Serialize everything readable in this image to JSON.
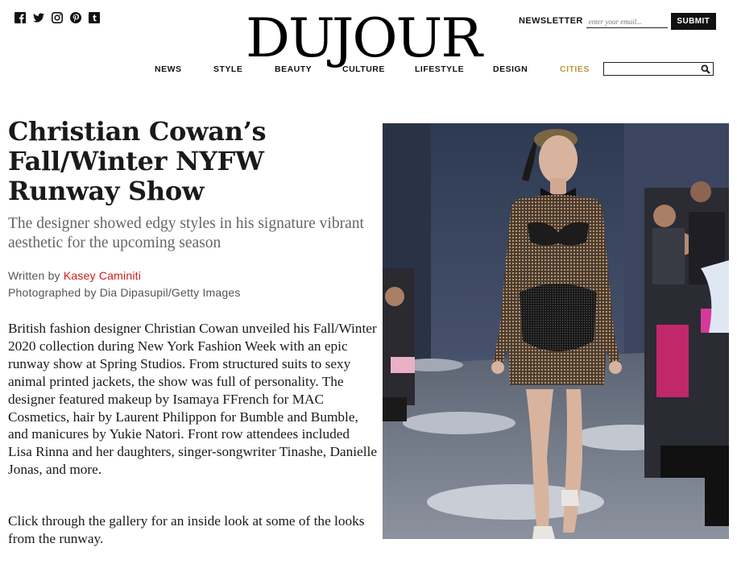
{
  "social": {
    "icons": [
      "facebook-icon",
      "twitter-icon",
      "instagram-icon",
      "pinterest-icon",
      "tumblr-icon"
    ]
  },
  "logo": {
    "text": "DUJOUR"
  },
  "newsletter": {
    "label": "NEWSLETTER",
    "placeholder": "enter your email...",
    "submit_label": "SUBMIT"
  },
  "nav": {
    "items": [
      "NEWS",
      "STYLE",
      "BEAUTY",
      "CULTURE",
      "LIFESTYLE",
      "DESIGN",
      "CITIES"
    ],
    "active_color": "#b89a3a"
  },
  "search": {
    "icon": "search-icon"
  },
  "article": {
    "headline": "Christian Cowan’s Fall/Winter NYFW Runway Show",
    "dek": "The designer showed edgy styles in his signature vibrant aesthetic for the upcoming season",
    "byline_prefix": "Written by ",
    "author": "Kasey Caminiti",
    "author_color": "#d11a1a",
    "photo_credit": "Photographed by Dia Dipasupil/Getty Images",
    "body_paragraph_1": "British fashion designer Christian Cowan unveiled his Fall/Winter 2020 collection during New York Fashion Week with an epic runway show at Spring Studios. From structured suits to sexy animal printed jackets, the show was full of personality. The designer featured makeup by Isamaya FFrench for MAC Cosmetics, hair by Laurent Philippon for Bumble and Bumble, and manicures by Yukie Natori. Front row attendees included Lisa Rinna and her daughters, singer-songwriter Tinashe, Danielle Jonas, and more.",
    "body_paragraph_2": "Click through the gallery for an inside look at some of the looks from the runway."
  }
}
